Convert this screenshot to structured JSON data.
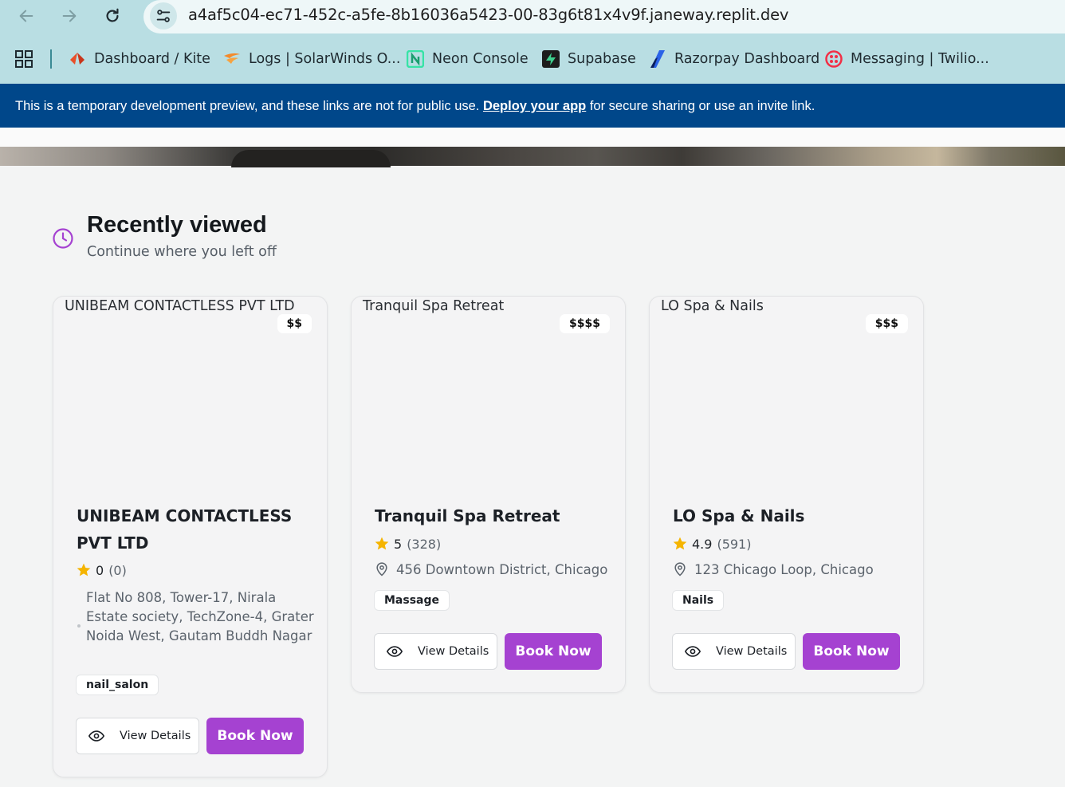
{
  "browser": {
    "url": "a4af5c04-ec71-452c-a5fe-8b16036a5423-00-83g6t81x4v9f.janeway.replit.dev",
    "bookmarks": [
      {
        "label": "Dashboard / Kite",
        "icon": "kite-icon",
        "color": "#e8502a"
      },
      {
        "label": "Logs | SolarWinds O...",
        "icon": "solarwinds-icon",
        "color": "#f38a2b"
      },
      {
        "label": "Neon Console",
        "icon": "neon-icon",
        "color": "#37e3a6"
      },
      {
        "label": "Supabase",
        "icon": "supabase-icon",
        "color": "#3ecf8e"
      },
      {
        "label": "Razorpay Dashboard",
        "icon": "razorpay-icon",
        "color": "#2b63e8"
      },
      {
        "label": "Messaging | Twilio...",
        "icon": "twilio-icon",
        "color": "#f22f46"
      }
    ]
  },
  "banner": {
    "text_before": "This is a temporary development preview, and these links are not for public use. ",
    "link": "Deploy your app",
    "text_after": " for secure sharing or use an invite link."
  },
  "section": {
    "title": "Recently viewed",
    "subtitle": "Continue where you left off",
    "accent_color": "#a542d1"
  },
  "cards": [
    {
      "image_alt": "UNIBEAM CONTACTLESS PVT LTD",
      "price": "$$",
      "name": "UNIBEAM CONTACTLESS PVT LTD",
      "rating": "0",
      "reviews": "(0)",
      "address": "Flat No 808, Tower-17, Nirala Estate society, TechZone-4, Grater Noida West, Gautam Buddh Nagar",
      "tag": "nail_salon",
      "view_label": "View Details",
      "book_label": "Book Now"
    },
    {
      "image_alt": "Tranquil Spa Retreat",
      "price": "$$$$",
      "name": "Tranquil Spa Retreat",
      "rating": "5",
      "reviews": "(328)",
      "address": "456 Downtown District, Chicago",
      "tag": "Massage",
      "view_label": "View Details",
      "book_label": "Book Now"
    },
    {
      "image_alt": "LO Spa & Nails",
      "price": "$$$",
      "name": "LO Spa & Nails",
      "rating": "4.9",
      "reviews": "(591)",
      "address": "123 Chicago Loop, Chicago",
      "tag": "Nails",
      "view_label": "View Details",
      "book_label": "Book Now"
    }
  ]
}
